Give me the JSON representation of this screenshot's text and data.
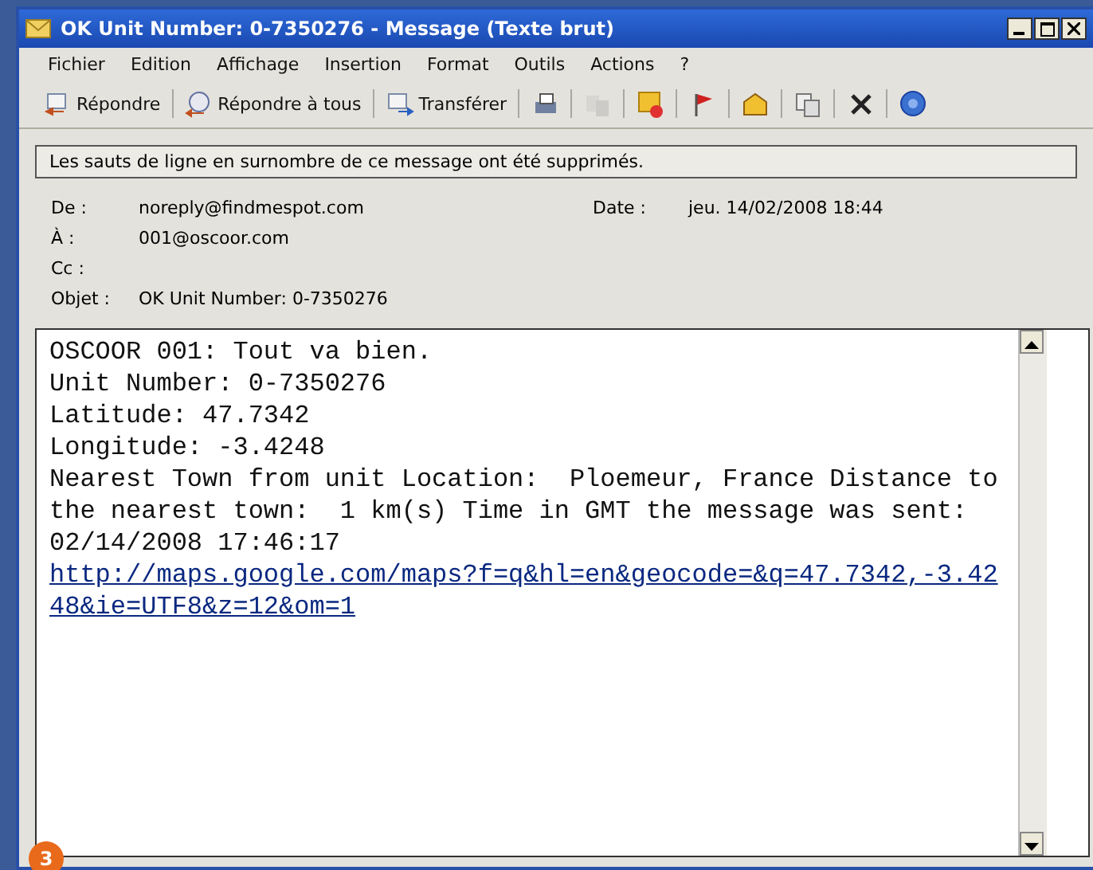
{
  "window": {
    "title": "OK Unit Number: 0-7350276 - Message (Texte brut)"
  },
  "menu": [
    "Fichier",
    "Edition",
    "Affichage",
    "Insertion",
    "Format",
    "Outils",
    "Actions",
    "?"
  ],
  "toolbar": [
    {
      "kind": "labeled",
      "label": "Répondre",
      "disabled": false
    },
    {
      "kind": "labeled",
      "label": "Répondre à tous",
      "disabled": false
    },
    {
      "kind": "labeled",
      "label": "Transférer",
      "disabled": false
    },
    {
      "kind": "icon",
      "disabled": false
    },
    {
      "kind": "icon",
      "disabled": true
    },
    {
      "kind": "icon",
      "disabled": false
    },
    {
      "kind": "icon",
      "disabled": false
    },
    {
      "kind": "icon",
      "disabled": false
    },
    {
      "kind": "icon",
      "disabled": false
    },
    {
      "kind": "icon",
      "disabled": false
    },
    {
      "kind": "icon",
      "disabled": false
    }
  ],
  "info_bar": "Les sauts de ligne en surnombre de ce message ont été supprimés.",
  "headers": {
    "from_label": "De :",
    "from": "noreply@findmespot.com",
    "date_label": "Date :",
    "date": "jeu. 14/02/2008 18:44",
    "to_label": "À :",
    "to": "001@oscoor.com",
    "cc_label": "Cc :",
    "subject_label": "Objet :",
    "subject": "OK Unit Number: 0-7350276"
  },
  "body": {
    "lines": [
      "OSCOOR 001: Tout va bien.",
      "Unit Number: 0-7350276",
      "Latitude: 47.7342",
      "Longitude: -3.4248",
      "Nearest Town from unit Location:  Ploemeur, France Distance to the nearest town:  1 km(s) Time in GMT the message was sent: 02/14/2008 17:46:17"
    ],
    "link": "http://maps.google.com/maps?f=q&hl=en&geocode=&q=47.7342,-3.4248&ie=UTF8&z=12&om=1"
  },
  "callout_badge": "3"
}
